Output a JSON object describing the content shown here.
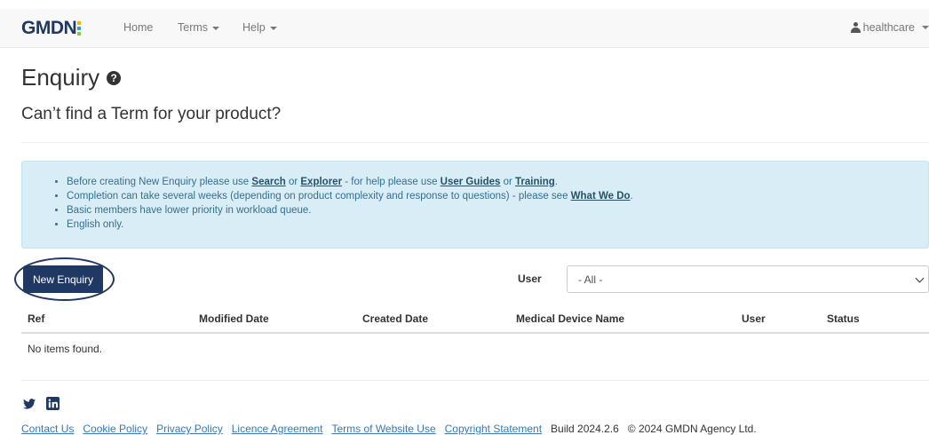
{
  "brand": {
    "name_part1": "GMD",
    "name_part2": "N",
    "colors": {
      "primary": "#1f3864",
      "accent1": "#f2b705",
      "accent2": "#2aa8a8",
      "accent3": "#8dc63f"
    }
  },
  "nav": {
    "home": "Home",
    "terms": "Terms",
    "help": "Help",
    "user": "healthcare"
  },
  "page": {
    "title": "Enquiry",
    "help_icon": "question-circle-icon",
    "subtitle": "Can’t find a Term for your product?"
  },
  "info": {
    "line1": {
      "t1": "Before creating New Enquiry please use ",
      "search": "Search",
      "t2": " or ",
      "explorer": "Explorer",
      "t3": " - for help please use ",
      "guides": "User Guides",
      "t4": " or ",
      "training": "Training",
      "t5": "."
    },
    "line2": {
      "t1": "Completion can take several weeks (depending on product complexity and response to questions) - please see ",
      "whatwedo": "What We Do",
      "t2": "."
    },
    "line3": "Basic members have lower priority in workload queue.",
    "line4": "English only."
  },
  "toolbar": {
    "new_enquiry": "New Enquiry",
    "user_label": "User",
    "user_select_value": "- All -"
  },
  "table": {
    "columns": [
      "Ref",
      "Modified Date",
      "Created Date",
      "Medical Device Name",
      "User",
      "Status"
    ],
    "empty": "No items found."
  },
  "footer": {
    "social_icons": [
      "twitter-icon",
      "linkedin-icon"
    ],
    "links": [
      "Contact Us",
      "Cookie Policy",
      "Privacy Policy",
      "Licence Agreement",
      "Terms of Website Use",
      "Copyright Statement"
    ],
    "build": "Build 2024.2.6",
    "copyright": "© 2024 GMDN Agency Ltd."
  }
}
